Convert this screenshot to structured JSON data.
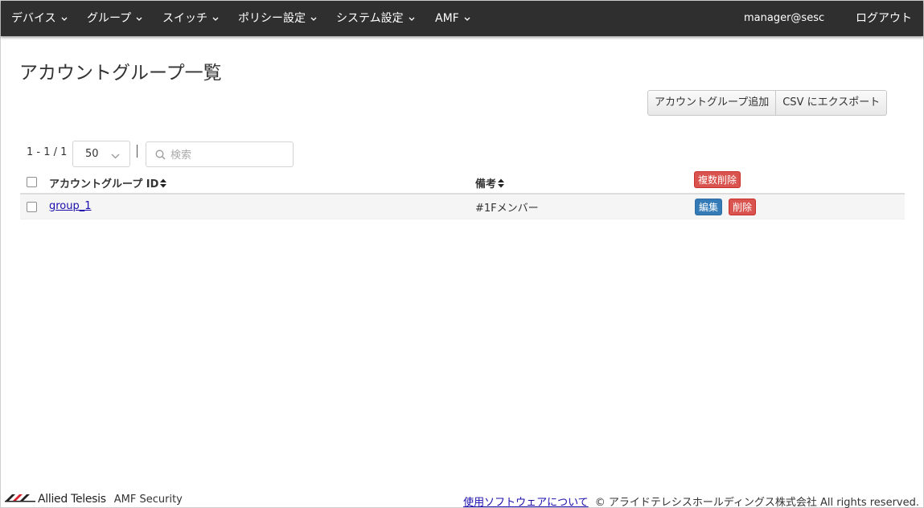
{
  "nav": {
    "items": [
      {
        "label": "デバイス"
      },
      {
        "label": "グループ"
      },
      {
        "label": "スイッチ"
      },
      {
        "label": "ポリシー設定"
      },
      {
        "label": "システム設定"
      },
      {
        "label": "AMF"
      }
    ],
    "user": "manager@sesc",
    "logout": "ログアウト"
  },
  "page": {
    "title": "アカウントグループ一覧",
    "add_button": "アカウントグループ追加",
    "export_button": "CSV にエクスポート"
  },
  "list": {
    "count": "1 - 1 / 1",
    "page_size": "50",
    "search_placeholder": "検索"
  },
  "table": {
    "columns": {
      "id": "アカウントグループ ID",
      "note": "備考"
    },
    "bulk_delete": "複数削除",
    "rows": [
      {
        "id": "group_1",
        "note": "#1Fメンバー",
        "edit": "編集",
        "delete": "削除"
      }
    ]
  },
  "footer": {
    "brand": "Allied Telesis",
    "product": "AMF Security",
    "about_link": "使用ソフトウェアについて",
    "copyright": "© アライドテレシスホールディングス株式会社 All rights reserved."
  },
  "colors": {
    "navbar": "#2f2f2f",
    "danger": "#d9534f",
    "primary": "#337ab7",
    "link": "#1a0dab"
  }
}
